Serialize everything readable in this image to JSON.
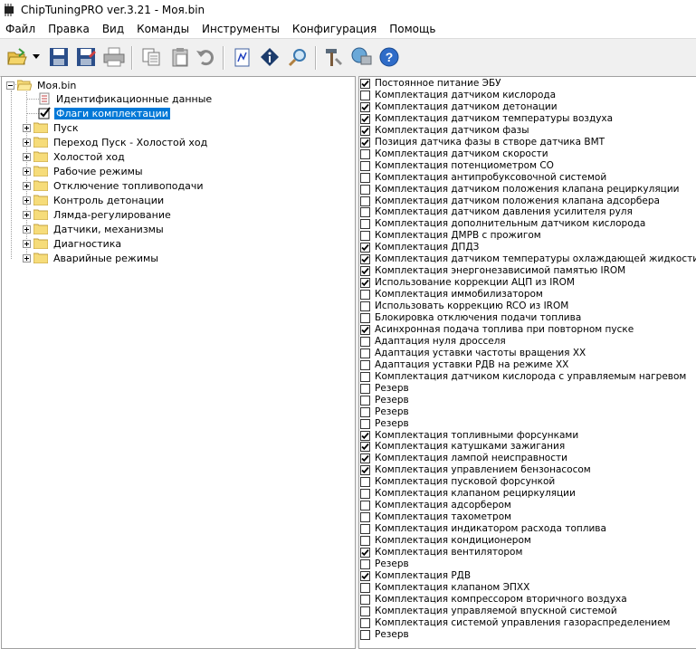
{
  "window": {
    "title": "ChipTuningPRO ver.3.21 - Моя.bin",
    "app_icon": "chip-icon"
  },
  "menu": [
    "Файл",
    "Правка",
    "Вид",
    "Команды",
    "Инструменты",
    "Конфигурация",
    "Помощь"
  ],
  "toolbar": [
    {
      "name": "open-folder-icon"
    },
    {
      "name": "dropdown-arrow-icon"
    },
    {
      "name": "save-icon"
    },
    {
      "name": "save-as-icon"
    },
    {
      "name": "print-icon"
    },
    {
      "name": "copy-icon"
    },
    {
      "name": "paste-icon"
    },
    {
      "name": "undo-icon"
    },
    {
      "name": "edit-document-icon"
    },
    {
      "name": "info-icon"
    },
    {
      "name": "search-icon"
    },
    {
      "name": "tools-icon"
    },
    {
      "name": "connect-icon"
    },
    {
      "name": "help-icon"
    }
  ],
  "tree": {
    "root": "Моя.bin",
    "children": [
      {
        "label": "Идентификационные данные",
        "icon": "document-icon"
      },
      {
        "label": "Флаги комплектации",
        "icon": "checkbox-icon",
        "selected": true
      },
      {
        "label": "Пуск",
        "icon": "folder-icon"
      },
      {
        "label": "Переход Пуск - Холостой ход",
        "icon": "folder-icon"
      },
      {
        "label": "Холостой ход",
        "icon": "folder-icon"
      },
      {
        "label": "Рабочие режимы",
        "icon": "folder-icon"
      },
      {
        "label": "Отключение топливоподачи",
        "icon": "folder-icon"
      },
      {
        "label": "Контроль детонации",
        "icon": "folder-icon"
      },
      {
        "label": "Лямда-регулирование",
        "icon": "folder-icon"
      },
      {
        "label": "Датчики, механизмы",
        "icon": "folder-icon"
      },
      {
        "label": "Диагностика",
        "icon": "folder-icon"
      },
      {
        "label": "Аварийные режимы",
        "icon": "folder-icon"
      }
    ]
  },
  "flags": [
    {
      "label": "Постоянное питание ЭБУ",
      "checked": true
    },
    {
      "label": "Комплектация датчиком кислорода",
      "checked": false
    },
    {
      "label": "Комплектация датчиком детонации",
      "checked": true
    },
    {
      "label": "Комплектация датчиком температуры воздуха",
      "checked": true
    },
    {
      "label": "Комплектация датчиком фазы",
      "checked": true
    },
    {
      "label": "Позиция датчика фазы в створе датчика ВМТ",
      "checked": true
    },
    {
      "label": "Комплектация датчиком скорости",
      "checked": false
    },
    {
      "label": "Комплектация потенциометром СО",
      "checked": false
    },
    {
      "label": "Комплектация антипробуксовочной системой",
      "checked": false
    },
    {
      "label": "Комплектация датчиком положения клапана рециркуляции",
      "checked": false
    },
    {
      "label": "Комплектация датчиком положения клапана адсорбера",
      "checked": false
    },
    {
      "label": "Комплектация датчиком давления усилителя руля",
      "checked": false
    },
    {
      "label": "Комплектация дополнительным датчиком кислорода",
      "checked": false
    },
    {
      "label": "Комплектация ДМРВ с прожигом",
      "checked": false
    },
    {
      "label": "Комплектация ДПДЗ",
      "checked": true
    },
    {
      "label": "Комплектация датчиком температуры охлаждающей жидкости",
      "checked": true
    },
    {
      "label": "Комплектация энергонезависимой памятью IROM",
      "checked": true
    },
    {
      "label": "Использование коррекции АЦП из IROM",
      "checked": true
    },
    {
      "label": "Комплектация иммобилизатором",
      "checked": false
    },
    {
      "label": "Использовать коррекцию RCO из IROM",
      "checked": false
    },
    {
      "label": "Блокировка отключения подачи топлива",
      "checked": false
    },
    {
      "label": "Асинхронная подача топлива при повторном пуске",
      "checked": true
    },
    {
      "label": "Адаптация нуля дросселя",
      "checked": false
    },
    {
      "label": "Адаптация уставки частоты вращения ХХ",
      "checked": false
    },
    {
      "label": "Адаптация уставки РДВ на режиме ХХ",
      "checked": false
    },
    {
      "label": "Комплектация датчиком кислорода с управляемым нагревом",
      "checked": false
    },
    {
      "label": "Резерв",
      "checked": false
    },
    {
      "label": "Резерв",
      "checked": false
    },
    {
      "label": "Резерв",
      "checked": false
    },
    {
      "label": "Резерв",
      "checked": false
    },
    {
      "label": "Комплектация топливными форсунками",
      "checked": true
    },
    {
      "label": "Комплектация катушками зажигания",
      "checked": true
    },
    {
      "label": "Комплектация лампой неисправности",
      "checked": true
    },
    {
      "label": "Комплектация управлением бензонасосом",
      "checked": true
    },
    {
      "label": "Комплектация пусковой форсункой",
      "checked": false
    },
    {
      "label": "Комплектация клапаном рециркуляции",
      "checked": false
    },
    {
      "label": "Комплектация адсорбером",
      "checked": false
    },
    {
      "label": "Комплектация тахометром",
      "checked": false
    },
    {
      "label": "Комплектация индикатором расхода топлива",
      "checked": false
    },
    {
      "label": "Комплектация кондиционером",
      "checked": false
    },
    {
      "label": "Комплектация вентилятором",
      "checked": true
    },
    {
      "label": "Резерв",
      "checked": false
    },
    {
      "label": "Комплектация РДВ",
      "checked": true
    },
    {
      "label": "Комплектация клапаном ЭПХХ",
      "checked": false
    },
    {
      "label": "Комплектация компрессором вторичного воздуха",
      "checked": false
    },
    {
      "label": "Комплектация управляемой впускной системой",
      "checked": false
    },
    {
      "label": "Комплектация системой управления газораспределением",
      "checked": false
    },
    {
      "label": "Резерв",
      "checked": false
    }
  ]
}
